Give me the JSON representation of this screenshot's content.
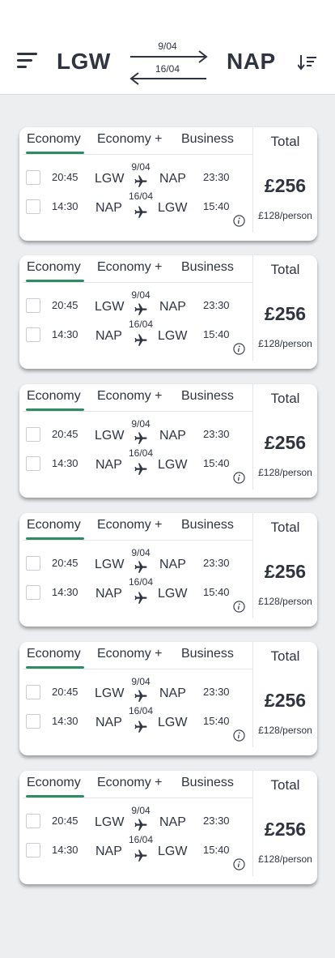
{
  "header": {
    "origin": "LGW",
    "destination": "NAP",
    "outbound_date": "9/04",
    "return_date": "16/04",
    "menu_icon": "hamburger-menu-icon",
    "sort_icon": "sort-descending-icon"
  },
  "colors": {
    "accent": "#2e8b64",
    "text": "#2f3440",
    "background": "#eceef0"
  },
  "cards": [
    {
      "tabs": [
        "Economy",
        "Economy +",
        "Business"
      ],
      "selected_tab": "Economy",
      "total_label": "Total",
      "price": "£256",
      "per_person": "£128/person",
      "outbound": {
        "depart_time": "20:45",
        "from": "LGW",
        "date": "9/04",
        "to": "NAP",
        "arrive_time": "23:30"
      },
      "inbound": {
        "depart_time": "14:30",
        "from": "NAP",
        "date": "16/04",
        "to": "LGW",
        "arrive_time": "15:40"
      }
    },
    {
      "tabs": [
        "Economy",
        "Economy +",
        "Business"
      ],
      "selected_tab": "Economy",
      "total_label": "Total",
      "price": "£256",
      "per_person": "£128/person",
      "outbound": {
        "depart_time": "20:45",
        "from": "LGW",
        "date": "9/04",
        "to": "NAP",
        "arrive_time": "23:30"
      },
      "inbound": {
        "depart_time": "14:30",
        "from": "NAP",
        "date": "16/04",
        "to": "LGW",
        "arrive_time": "15:40"
      }
    },
    {
      "tabs": [
        "Economy",
        "Economy +",
        "Business"
      ],
      "selected_tab": "Economy",
      "total_label": "Total",
      "price": "£256",
      "per_person": "£128/person",
      "outbound": {
        "depart_time": "20:45",
        "from": "LGW",
        "date": "9/04",
        "to": "NAP",
        "arrive_time": "23:30"
      },
      "inbound": {
        "depart_time": "14:30",
        "from": "NAP",
        "date": "16/04",
        "to": "LGW",
        "arrive_time": "15:40"
      }
    },
    {
      "tabs": [
        "Economy",
        "Economy +",
        "Business"
      ],
      "selected_tab": "Economy",
      "total_label": "Total",
      "price": "£256",
      "per_person": "£128/person",
      "outbound": {
        "depart_time": "20:45",
        "from": "LGW",
        "date": "9/04",
        "to": "NAP",
        "arrive_time": "23:30"
      },
      "inbound": {
        "depart_time": "14:30",
        "from": "NAP",
        "date": "16/04",
        "to": "LGW",
        "arrive_time": "15:40"
      }
    },
    {
      "tabs": [
        "Economy",
        "Economy +",
        "Business"
      ],
      "selected_tab": "Economy",
      "total_label": "Total",
      "price": "£256",
      "per_person": "£128/person",
      "outbound": {
        "depart_time": "20:45",
        "from": "LGW",
        "date": "9/04",
        "to": "NAP",
        "arrive_time": "23:30"
      },
      "inbound": {
        "depart_time": "14:30",
        "from": "NAP",
        "date": "16/04",
        "to": "LGW",
        "arrive_time": "15:40"
      }
    },
    {
      "tabs": [
        "Economy",
        "Economy +",
        "Business"
      ],
      "selected_tab": "Economy",
      "total_label": "Total",
      "price": "£256",
      "per_person": "£128/person",
      "outbound": {
        "depart_time": "20:45",
        "from": "LGW",
        "date": "9/04",
        "to": "NAP",
        "arrive_time": "23:30"
      },
      "inbound": {
        "depart_time": "14:30",
        "from": "NAP",
        "date": "16/04",
        "to": "LGW",
        "arrive_time": "15:40"
      }
    }
  ]
}
